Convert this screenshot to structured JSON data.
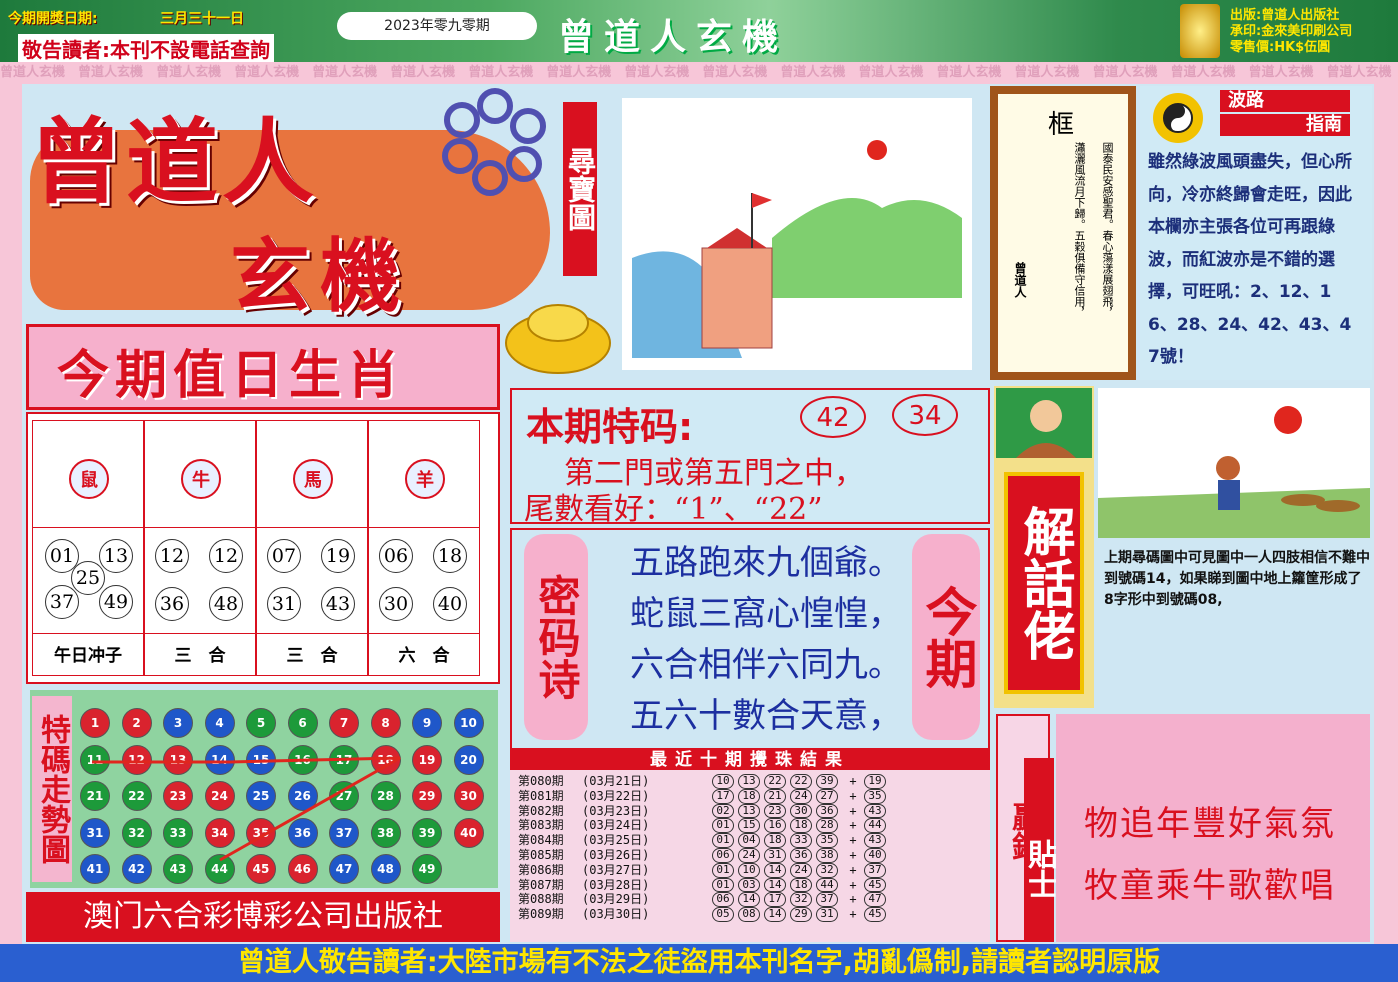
{
  "header": {
    "open_date_label": "今期開獎日期:",
    "open_date": "三月三十一日",
    "notice": "敬告讀者:本刊不設電話查詢",
    "issue": "2023年零九零期",
    "masthead": "曾道人玄機",
    "publisher": "出版:曾道人出版社",
    "printer": "承印:金來美印刷公司",
    "price": "零售價:HK$伍圓"
  },
  "border_text": "曾道人玄機",
  "logo": {
    "line1": "曾道人",
    "line2": "玄機",
    "tag": "尋寶圖"
  },
  "zodiac": {
    "title": "今期值日生肖",
    "cols": [
      {
        "animal": "鼠",
        "nums": [
          "01",
          "13",
          "25",
          "37",
          "49"
        ],
        "note": "午日冲子"
      },
      {
        "animal": "牛",
        "nums": [
          "12",
          "12",
          "36",
          "48"
        ],
        "note": "三　合"
      },
      {
        "animal": "馬",
        "nums": [
          "07",
          "19",
          "31",
          "43"
        ],
        "note": "三　合"
      },
      {
        "animal": "羊",
        "nums": [
          "06",
          "18",
          "30",
          "40"
        ],
        "note": "六　合"
      }
    ]
  },
  "trend": {
    "title": "特碼走勢圖",
    "balls": [
      [
        "1",
        "red"
      ],
      [
        "2",
        "red"
      ],
      [
        "3",
        "blue"
      ],
      [
        "4",
        "blue"
      ],
      [
        "5",
        "green"
      ],
      [
        "6",
        "green"
      ],
      [
        "7",
        "red"
      ],
      [
        "8",
        "red"
      ],
      [
        "9",
        "blue"
      ],
      [
        "10",
        "blue"
      ],
      [
        "11",
        "green"
      ],
      [
        "12",
        "red"
      ],
      [
        "13",
        "red"
      ],
      [
        "14",
        "blue"
      ],
      [
        "15",
        "blue"
      ],
      [
        "16",
        "green"
      ],
      [
        "17",
        "green"
      ],
      [
        "18",
        "red"
      ],
      [
        "19",
        "red"
      ],
      [
        "20",
        "blue"
      ],
      [
        "21",
        "green"
      ],
      [
        "22",
        "green"
      ],
      [
        "23",
        "red"
      ],
      [
        "24",
        "red"
      ],
      [
        "25",
        "blue"
      ],
      [
        "26",
        "blue"
      ],
      [
        "27",
        "green"
      ],
      [
        "28",
        "green"
      ],
      [
        "29",
        "red"
      ],
      [
        "30",
        "red"
      ],
      [
        "31",
        "blue"
      ],
      [
        "32",
        "green"
      ],
      [
        "33",
        "green"
      ],
      [
        "34",
        "red"
      ],
      [
        "35",
        "red"
      ],
      [
        "36",
        "blue"
      ],
      [
        "37",
        "blue"
      ],
      [
        "38",
        "green"
      ],
      [
        "39",
        "green"
      ],
      [
        "40",
        "red"
      ],
      [
        "41",
        "blue"
      ],
      [
        "42",
        "blue"
      ],
      [
        "43",
        "green"
      ],
      [
        "44",
        "green"
      ],
      [
        "45",
        "red"
      ],
      [
        "46",
        "red"
      ],
      [
        "47",
        "blue"
      ],
      [
        "48",
        "blue"
      ],
      [
        "49",
        "green"
      ]
    ],
    "publisher": "澳门六合彩博彩公司出版社"
  },
  "special": {
    "label": "本期特码:",
    "nums": [
      "42",
      "34"
    ],
    "line1": "第二門或第五門之中，",
    "line2": "尾數看好：“1”、“22”"
  },
  "poem": {
    "left_tag": "密码诗",
    "right_tag": "今期",
    "lines": [
      "五路跑來九個爺。",
      "蛇鼠三窩心惶惶，",
      "六合相伴六同九。",
      "五六十數合天意，"
    ]
  },
  "results": {
    "title": "最近十期攪珠結果",
    "rows": [
      {
        "period": "第080期",
        "date": "(03月21日)",
        "nums": [
          "10",
          "13",
          "22",
          "22",
          "39"
        ],
        "sp": "19"
      },
      {
        "period": "第081期",
        "date": "(03月22日)",
        "nums": [
          "17",
          "18",
          "21",
          "24",
          "27"
        ],
        "sp": "35"
      },
      {
        "period": "第082期",
        "date": "(03月23日)",
        "nums": [
          "02",
          "13",
          "23",
          "30",
          "36"
        ],
        "sp": "43"
      },
      {
        "period": "第083期",
        "date": "(03月24日)",
        "nums": [
          "01",
          "15",
          "16",
          "18",
          "28"
        ],
        "sp": "44"
      },
      {
        "period": "第084期",
        "date": "(03月25日)",
        "nums": [
          "01",
          "04",
          "18",
          "33",
          "35"
        ],
        "sp": "43"
      },
      {
        "period": "第085期",
        "date": "(03月26日)",
        "nums": [
          "06",
          "24",
          "31",
          "36",
          "38"
        ],
        "sp": "40"
      },
      {
        "period": "第086期",
        "date": "(03月27日)",
        "nums": [
          "01",
          "10",
          "14",
          "24",
          "32"
        ],
        "sp": "37"
      },
      {
        "period": "第087期",
        "date": "(03月28日)",
        "nums": [
          "01",
          "03",
          "14",
          "18",
          "44"
        ],
        "sp": "45"
      },
      {
        "period": "第088期",
        "date": "(03月29日)",
        "nums": [
          "06",
          "14",
          "17",
          "32",
          "37"
        ],
        "sp": "47"
      },
      {
        "period": "第089期",
        "date": "(03月30日)",
        "nums": [
          "05",
          "08",
          "14",
          "29",
          "31"
        ],
        "sp": "45"
      }
    ]
  },
  "plaque": {
    "title": "框",
    "poem1": "國泰民安感聖君。春心蕩漾展翅飛，",
    "poem2": "瀟灑風流月下歸。五穀俱備守信用，",
    "sign": "曾道人"
  },
  "wave": {
    "title1": "波路",
    "title2": "指南",
    "text": "雖然綠波風頭盡失，但心所向，冷亦終歸會走旺，因此本欄亦主張各位可再跟綠波，而紅波亦是不錯的選擇，可旺吼：2、12、16、28、24、42、43、47號！"
  },
  "explain": {
    "tag": "解話佬",
    "text": "上期尋碼圖中可見圖中一人四肢相信不難中到號碼14，如果睇到圖中地上籮筐形成了8字形中到號碼08,"
  },
  "money": {
    "tag1": "贏錢",
    "tag2": "貼士",
    "line1": "物追年豐好氣氛",
    "line2": "牧童乘牛歌歡唱"
  },
  "footer": "曾道人敬告讀者:大陸市場有不法之徒盜用本刊名字,胡亂僞制,請讀者認明原版"
}
